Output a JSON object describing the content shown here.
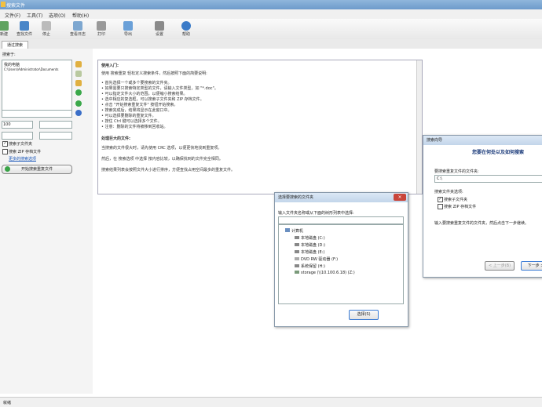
{
  "window": {
    "title": "搜索文件"
  },
  "menu": [
    "文件(F)",
    "工具(T)",
    "选项(O)",
    "帮助(H)"
  ],
  "toolbar": [
    {
      "label": "新建",
      "icon": "new-icon"
    },
    {
      "label": "查找文件",
      "icon": "find-icon"
    },
    {
      "label": "停止",
      "icon": "stop-icon"
    },
    {
      "label": "查看日志",
      "icon": "log-icon"
    },
    {
      "label": "打印",
      "icon": "print-icon"
    },
    {
      "label": "导出",
      "icon": "export-icon"
    },
    {
      "label": "设置",
      "icon": "settings-icon"
    },
    {
      "label": "帮助",
      "icon": "help-icon"
    }
  ],
  "tab": {
    "label": "通过搜索"
  },
  "left": {
    "search_label": "搜索于:",
    "path_items": [
      "我的电脑",
      "C:\\Users\\Administrator\\Documents"
    ],
    "size_value": "100",
    "subfolders_label": "搜索子文件夹",
    "zip_label": "搜索 ZIP 存档文件",
    "more_options_label": "更多的搜索选项",
    "start_button": "开始搜索重复文件"
  },
  "guide": {
    "heading": "使用入门:",
    "intro": "使用 搜索重复 轻松定义搜索条件，然后按照下面的简要说明:",
    "steps": [
      "• 首先选择一个或多个要搜索的文件夹。",
      "• 如果需要只搜索特定类型的文件，请输入文件类型，如 \"*.doc\"。",
      "• 可以指定文件大小的范围，以便缩小搜索结果。",
      "• 选中相应的复选框，可以搜索子文件夹和 ZIP 存档文件。",
      "• 点击 \"开始搜索重复文件\" 按钮开始搜索。",
      "• 搜索完成后，结果将显示在此窗口中。",
      "• 可以选择要删除的重复文件。",
      "• 按住 Ctrl 键可以选择多个文件。",
      "• 注意：删除的文件将被移到回收站。"
    ],
    "heading2": "处理巨大的文件:",
    "para1": "当搜索的文件很大时，请先使用 CRC 选项，以便更快地找到重复项。",
    "para2": "然后，在 搜索选项 中选择 按内容比较，以确保找到的文件完全相同。",
    "para3": "搜索结果列表会按照文件大小进行排序，方便查找占用空间最多的重复文件。"
  },
  "wizard": {
    "title": "搜索向导",
    "heading": "您要在何处以及如何搜索",
    "folder_label": "要搜索重复文件的文件夹:",
    "folder_value": "C:\\",
    "options_label": "搜索文件夹选项:",
    "opt1": "搜索子文件夹",
    "opt2": "搜索 ZIP 存档文件",
    "hint": "输入要搜索重复文件的文件夹，然后点击下一步继续。",
    "back": "< 上一步(B)",
    "next": "下一步 >"
  },
  "folder_dialog": {
    "title": "选择要搜索的文件夹",
    "prompt": "输入文件夹名称或从下面的树形列表中选择:",
    "tree": [
      "计算机",
      "本地磁盘 (C:)",
      "本地磁盘 (D:)",
      "本地磁盘 (E:)",
      "DVD RW 驱动器 (F:)",
      "系统保留 (H:)",
      "storage (\\\\10.100.6.18) (Z:)"
    ],
    "ok_label": "选择(S)"
  },
  "status": {
    "text": "就绪"
  }
}
